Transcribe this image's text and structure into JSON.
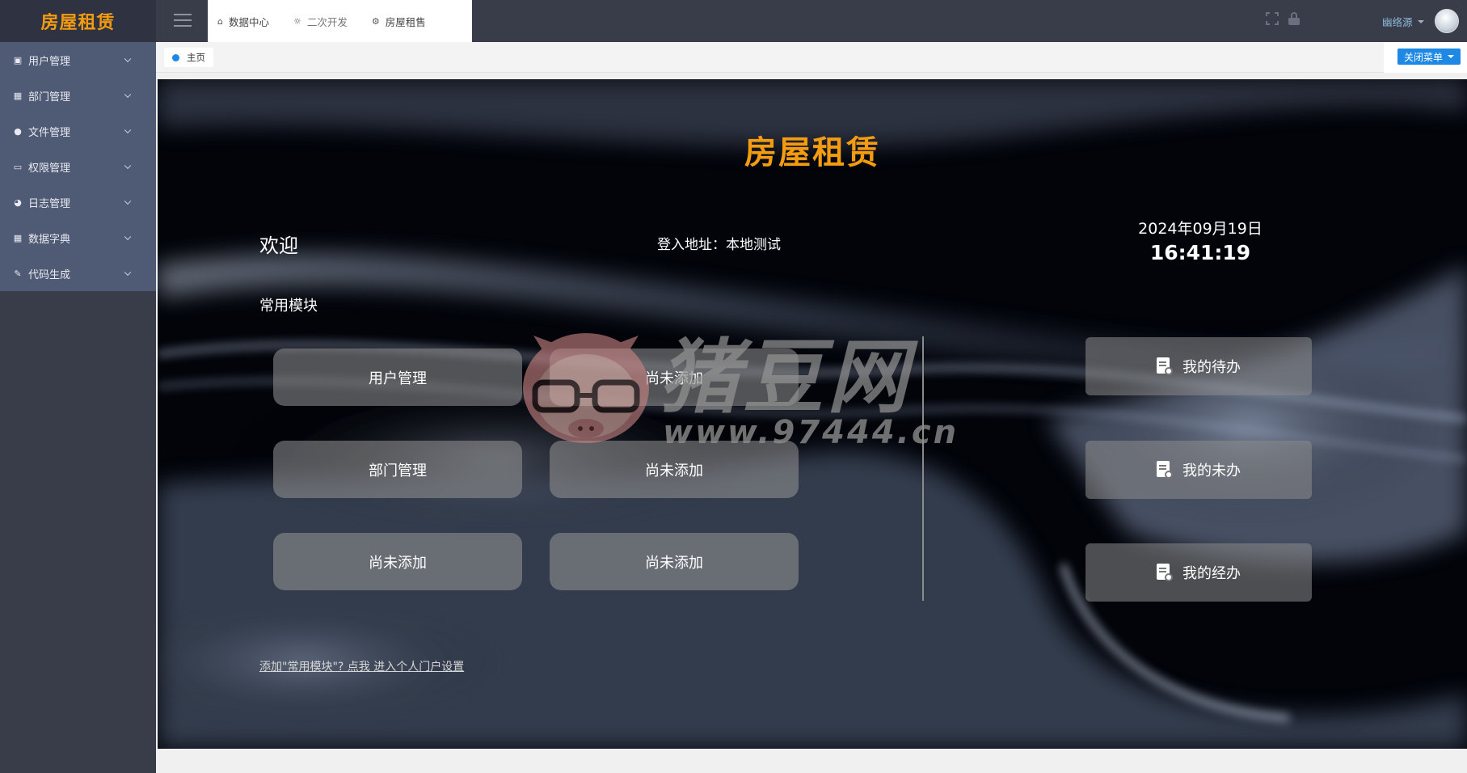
{
  "app": {
    "logo": "房屋租赁",
    "accent": "#f39c12"
  },
  "sidebar": {
    "items": [
      {
        "label": "用户管理",
        "icon": "picture-icon"
      },
      {
        "label": "部门管理",
        "icon": "grid-icon"
      },
      {
        "label": "文件管理",
        "icon": "globe-icon"
      },
      {
        "label": "权限管理",
        "icon": "monitor-icon"
      },
      {
        "label": "日志管理",
        "icon": "pie-icon"
      },
      {
        "label": "数据字典",
        "icon": "grid-icon"
      },
      {
        "label": "代码生成",
        "icon": "pencil-icon"
      }
    ]
  },
  "topbar": {
    "tabs": [
      {
        "label": "数据中心",
        "icon": "home-icon"
      },
      {
        "label": "二次开发",
        "icon": "bulb-icon"
      },
      {
        "label": "房屋租售",
        "icon": "gear-icon"
      }
    ],
    "user": "幽络源"
  },
  "tabbar": {
    "home": "主页",
    "close_menu": "关闭菜单"
  },
  "dashboard": {
    "title": "房屋租赁",
    "welcome": "欢迎",
    "login_address": "登入地址：本地测试",
    "date": "2024年09月19日",
    "time": "16:41:19",
    "common_modules_title": "常用模块",
    "modules": [
      "用户管理",
      "尚未添加",
      "部门管理",
      "尚未添加",
      "尚未添加",
      "尚未添加"
    ],
    "right_buttons": [
      "我的待办",
      "我的未办",
      "我的经办"
    ],
    "footer_link": "添加\"常用模块\"? 点我 进入个人门户设置"
  },
  "watermark": {
    "text": "猪豆网",
    "url": "www.97444.cn"
  }
}
